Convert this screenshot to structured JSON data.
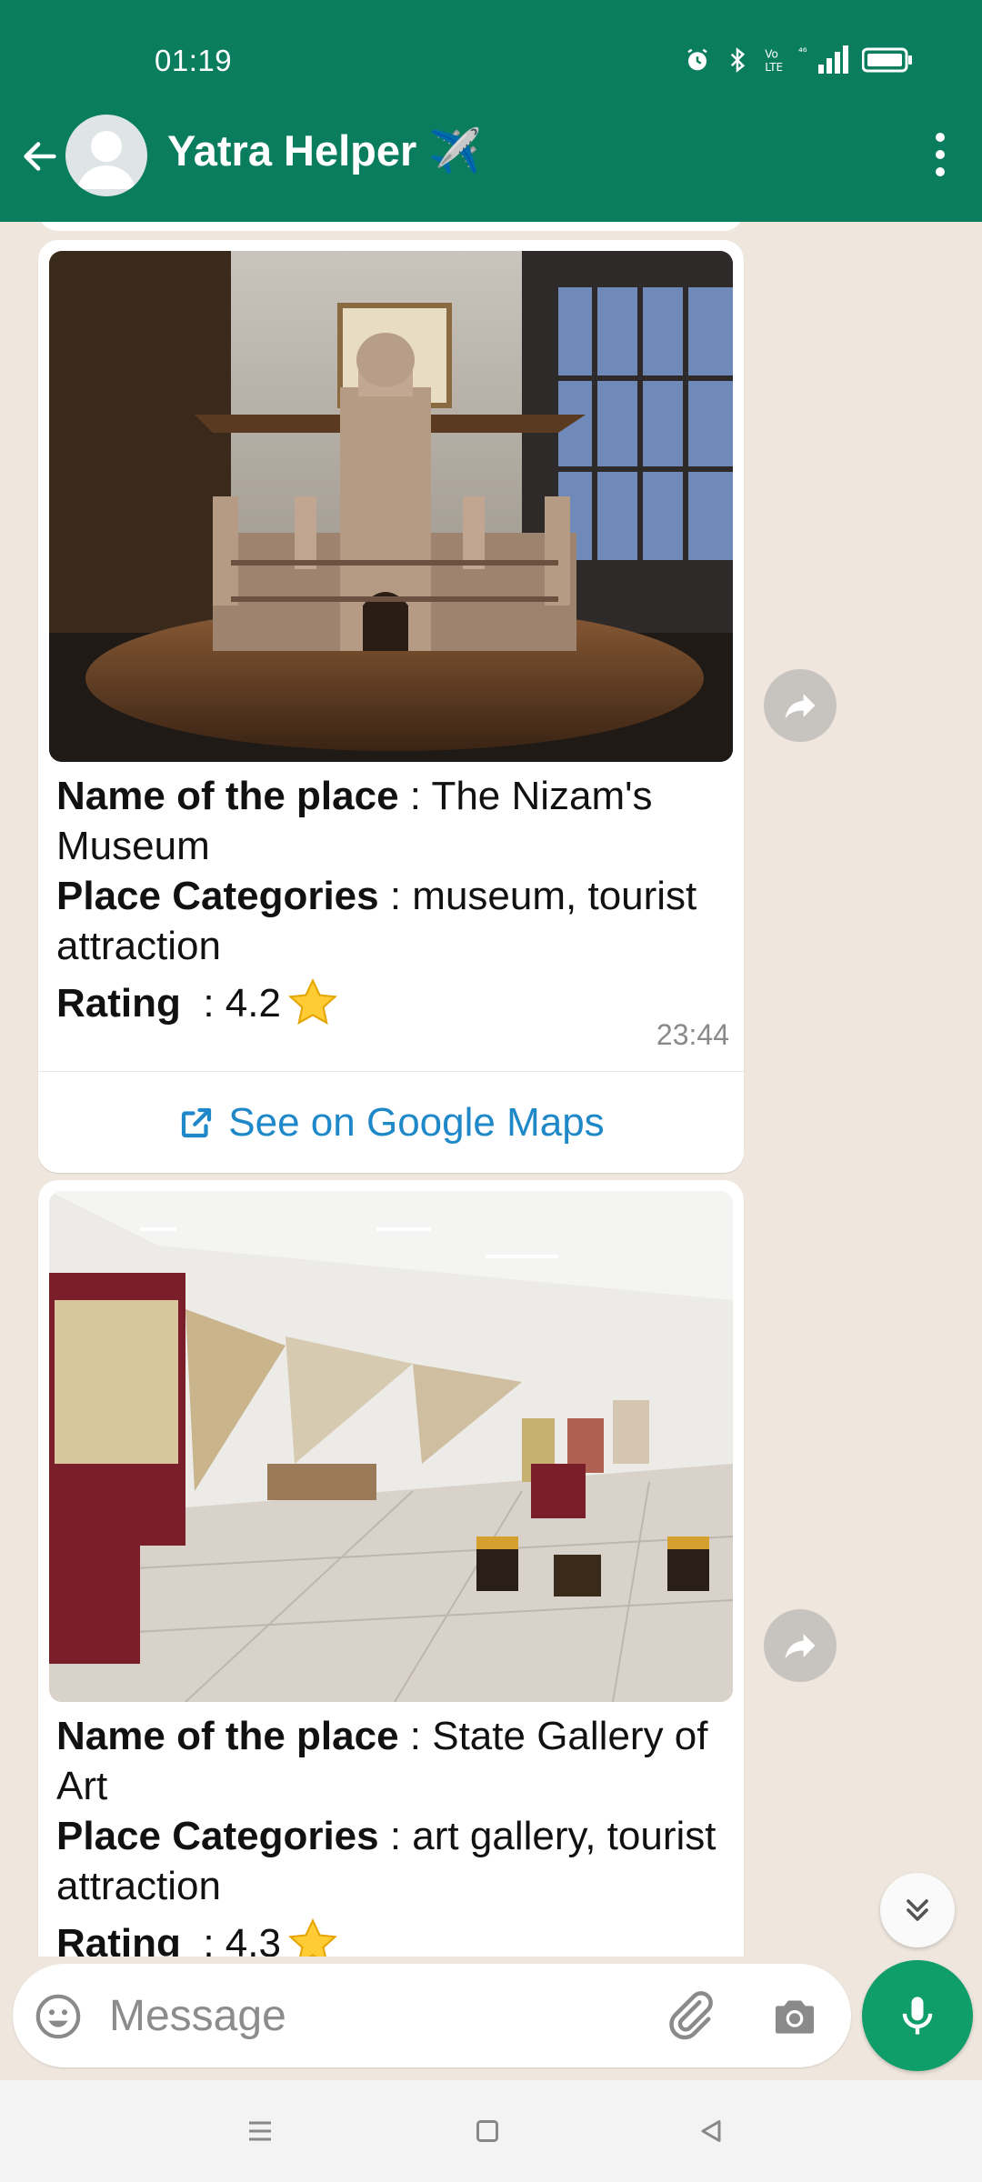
{
  "status_bar": {
    "time": "01:19",
    "icons": [
      "alarm-icon",
      "bluetooth-icon",
      "volte-icon",
      "signal-4g-icon",
      "battery-icon"
    ]
  },
  "app_bar": {
    "title": "Yatra Helper ✈️",
    "back_icon": "arrow-left-icon",
    "menu_icon": "more-vert-icon"
  },
  "messages": [
    {
      "image_desc_icon": "museum-photo",
      "name_label": "Name of the place",
      "name_value": " : The Nizam's Museum",
      "categories_label": "Place Categories",
      "categories_value": " : museum, tourist attraction",
      "rating_label": "Rating",
      "rating_value": "  : 4.2",
      "rating_star": "⭐",
      "time": "23:44",
      "link_label": "See on Google Maps",
      "link_icon": "external-link-icon"
    },
    {
      "image_desc_icon": "gallery-photo",
      "name_label": "Name of the place",
      "name_value": " : State Gallery of Art",
      "categories_label": "Place Categories",
      "categories_value": " : art gallery, tourist attraction",
      "rating_label": "Rating",
      "rating_value": "  : 4.3",
      "rating_star": "⭐"
    }
  ],
  "compose": {
    "placeholder": "Message",
    "value": ""
  },
  "colors": {
    "header": "#0b7d5f",
    "chat_bg": "#efe7de",
    "link": "#1e88c9",
    "mic": "#0f9d6a"
  }
}
